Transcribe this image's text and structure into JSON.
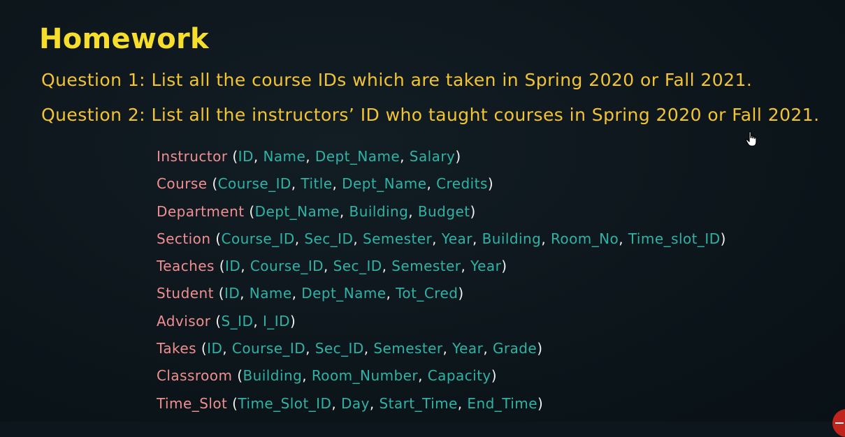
{
  "slide": {
    "title": "Homework",
    "questions": [
      "Question 1: List all the course IDs which are taken in Spring 2020 or Fall 2021.",
      "Question 2: List all the instructors’ ID who taught courses in Spring 2020 or Fall 2021."
    ]
  },
  "schema": [
    {
      "name": "Instructor",
      "attributes": [
        "ID",
        "Name",
        "Dept_Name",
        "Salary"
      ]
    },
    {
      "name": "Course",
      "attributes": [
        "Course_ID",
        "Title",
        "Dept_Name",
        "Credits"
      ]
    },
    {
      "name": "Department",
      "attributes": [
        "Dept_Name",
        "Building",
        "Budget"
      ]
    },
    {
      "name": "Section",
      "attributes": [
        "Course_ID",
        "Sec_ID",
        "Semester",
        "Year",
        "Building",
        "Room_No",
        "Time_slot_ID"
      ]
    },
    {
      "name": "Teaches",
      "attributes": [
        "ID",
        "Course_ID",
        "Sec_ID",
        "Semester",
        "Year"
      ]
    },
    {
      "name": "Student",
      "attributes": [
        "ID",
        "Name",
        "Dept_Name",
        "Tot_Cred"
      ]
    },
    {
      "name": "Advisor",
      "attributes": [
        "S_ID",
        "I_ID"
      ]
    },
    {
      "name": "Takes",
      "attributes": [
        "ID",
        "Course_ID",
        "Sec_ID",
        "Semester",
        "Year",
        "Grade"
      ]
    },
    {
      "name": "Classroom",
      "attributes": [
        "Building",
        "Room_Number",
        "Capacity"
      ]
    },
    {
      "name": "Time_Slot",
      "attributes": [
        "Time_Slot_ID",
        "Day",
        "Start_Time",
        "End_Time"
      ]
    }
  ],
  "colors": {
    "background": "#0c161c",
    "title": "#f7de2c",
    "question": "#f3c432",
    "relation_name": "#f08f91",
    "attribute": "#2fb3a6",
    "punctuation": "#f2f2f2"
  },
  "icons": {
    "cursor": "hand-pointer-icon",
    "corner": "red-circle-mark-icon"
  }
}
